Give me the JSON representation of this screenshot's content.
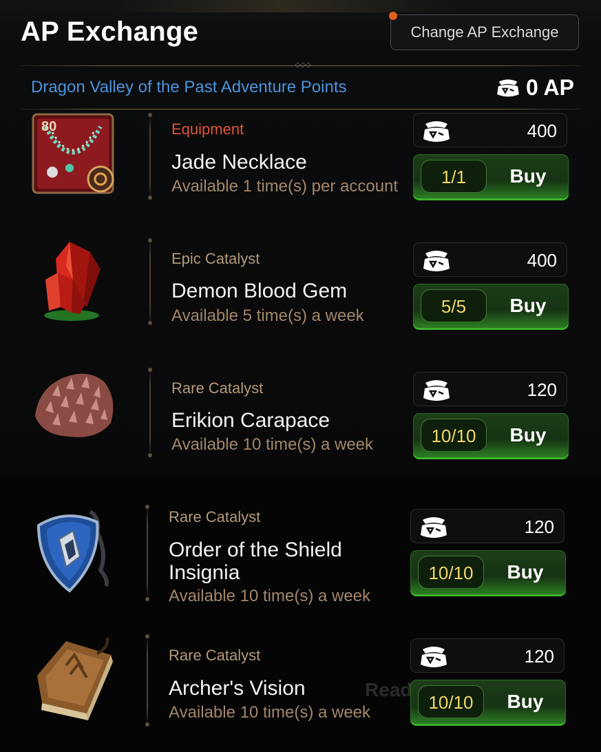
{
  "header": {
    "title": "AP Exchange",
    "change_button_label": "Change AP Exchange"
  },
  "section": {
    "name": "Dragon Valley of the Past Adventure Points",
    "ap_total": "0 AP"
  },
  "colors": {
    "category_equipment": "#e0543a",
    "category_catalyst": "#b39a7a",
    "section_name": "#4c93dd",
    "count_text": "#f2d66a",
    "buy_green": "#2c7c23"
  },
  "items": [
    {
      "category": "Equipment",
      "name": "Jade Necklace",
      "availability": "Available 1 time(s) per account",
      "price": "400",
      "purchases": "1/1",
      "buy_label": "Buy",
      "level_badge": "80",
      "icon": "jade-necklace-icon"
    },
    {
      "category": "Epic Catalyst",
      "name": "Demon Blood Gem",
      "availability": "Available 5 time(s) a week",
      "price": "400",
      "purchases": "5/5",
      "buy_label": "Buy",
      "icon": "red-gem-icon"
    },
    {
      "category": "Rare Catalyst",
      "name": "Erikion Carapace",
      "availability": "Available 10 time(s) a week",
      "price": "120",
      "purchases": "10/10",
      "buy_label": "Buy",
      "icon": "carapace-icon"
    },
    {
      "category": "Rare Catalyst",
      "name": "Order of the Shield Insignia",
      "availability": "Available 10 time(s) a week",
      "price": "120",
      "purchases": "10/10",
      "buy_label": "Buy",
      "icon": "shield-insignia-icon"
    },
    {
      "category": "Rare Catalyst",
      "name": "Archer's Vision",
      "availability": "Available 10 time(s) a week",
      "price": "120",
      "purchases": "10/10",
      "buy_label": "Buy",
      "icon": "book-icon"
    }
  ],
  "background_text": "Ready"
}
